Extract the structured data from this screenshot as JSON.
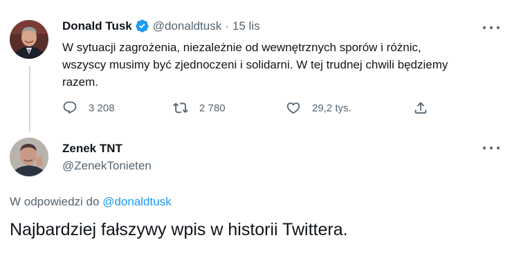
{
  "tweet": {
    "author_name": "Donald Tusk",
    "author_handle": "@donaldtusk",
    "separator": "·",
    "timestamp": "15 lis",
    "verified": true,
    "text_lines": [
      "W sytuacji zagrożenia, niezależnie od wewnętrznych sporów i różnic,",
      "wszyscy musimy być zjednoczeni i solidarni. W tej trudnej chwili będziemy",
      "razem."
    ],
    "actions": {
      "reply_icon": "reply-icon",
      "reply_count": "3 208",
      "retweet_icon": "retweet-icon",
      "retweet_count": "2 780",
      "like_icon": "heart-icon",
      "like_count": "29,2 tys.",
      "share_icon": "share-icon"
    }
  },
  "reply": {
    "author_name": "Zenek TNT",
    "author_handle": "@ZenekTonieten",
    "reply_prefix": "W odpowiedzi do",
    "reply_mention": "@donaldtusk",
    "text": "Najbardziej fałszywy wpis w historii Twittera."
  },
  "colors": {
    "text": "#0f1419",
    "secondary": "#536471",
    "accent": "#1d9bf0",
    "thread_line": "#cfd9de"
  }
}
